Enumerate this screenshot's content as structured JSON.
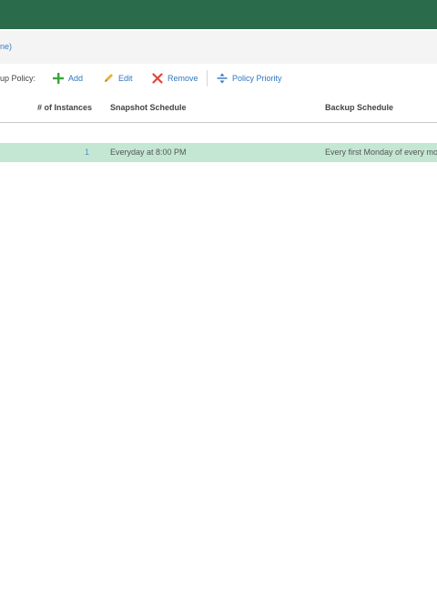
{
  "crumb": "ne)",
  "toolbar": {
    "label": "up Policy:",
    "add": "Add",
    "edit": "Edit",
    "remove": "Remove",
    "priority": "Policy Priority",
    "add_icon": "plus-icon",
    "edit_icon": "pencil-icon",
    "remove_icon": "x-icon",
    "priority_icon": "priority-arrows-icon"
  },
  "table": {
    "columns": [
      "# of Instances",
      "Snapshot Schedule",
      "Backup Schedule"
    ],
    "rows": [
      {
        "instances": "1",
        "snapshot": "Everyday at 8:00 PM",
        "backup": "Every first Monday of every mon"
      }
    ]
  },
  "colors": {
    "header": "#2a6b4b",
    "link": "#2f76c0",
    "row_highlight": "#c4e7d4",
    "add_icon": "#3aa63a",
    "edit_icon": "#e0a030",
    "remove_icon": "#e0453a"
  }
}
